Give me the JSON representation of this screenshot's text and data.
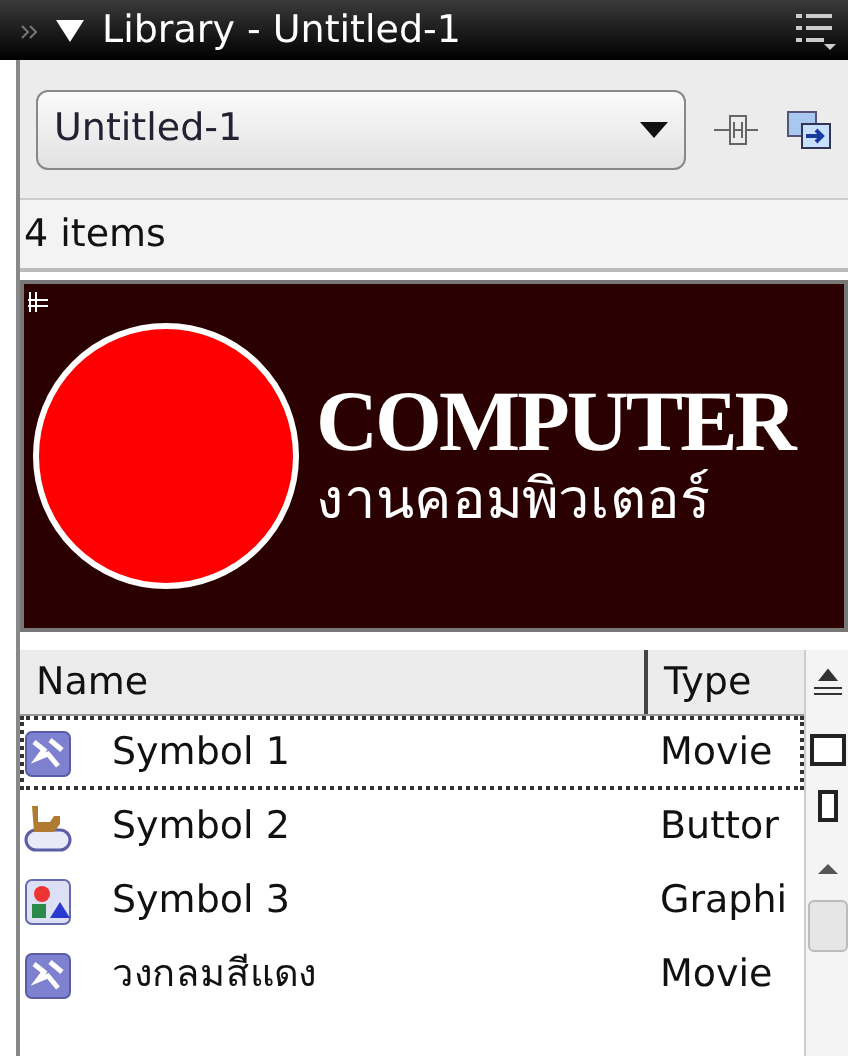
{
  "panel": {
    "title": "Library - Untitled-1",
    "expanded": true
  },
  "document_dropdown": {
    "value": "Untitled-1"
  },
  "item_count": "4 items",
  "preview": {
    "heading": "COMPUTER",
    "subheading": "งานคอมพิวเตอร์"
  },
  "columns": [
    "Name",
    "Type"
  ],
  "items": [
    {
      "name": "Symbol 1",
      "type": "Movie",
      "kind": "movie",
      "selected": true
    },
    {
      "name": "Symbol 2",
      "type": "Buttor",
      "kind": "button",
      "selected": false
    },
    {
      "name": "Symbol 3",
      "type": "Graphi",
      "kind": "graphic",
      "selected": false
    },
    {
      "name": "วงกลมสีแดง",
      "type": "Movie",
      "kind": "movie",
      "selected": false
    }
  ]
}
